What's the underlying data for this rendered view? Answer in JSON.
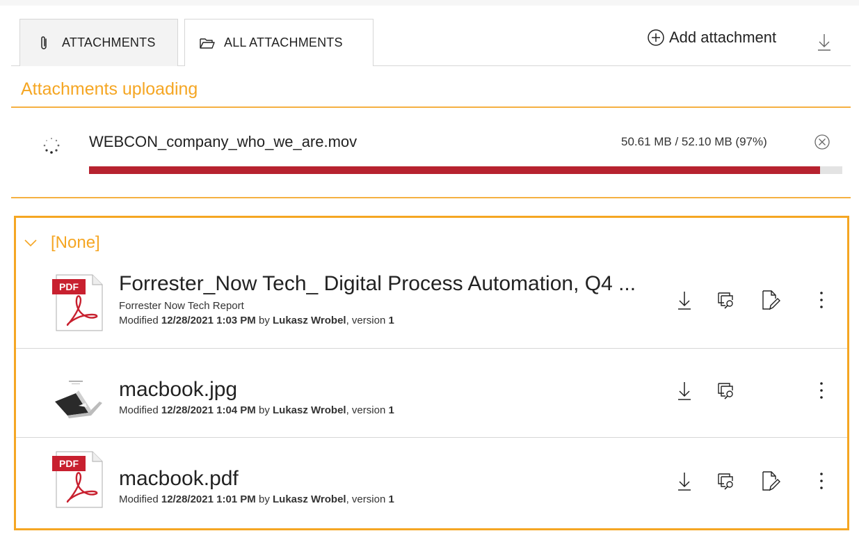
{
  "tabs": [
    {
      "label": "ATTACHMENTS",
      "icon": "paperclip-icon",
      "active": true
    },
    {
      "label": "ALL ATTACHMENTS",
      "icon": "folder-open-icon",
      "active": false
    }
  ],
  "toolbar": {
    "add_attachment_label": "Add attachment",
    "add_icon": "plus-circle-icon",
    "download_all_icon": "download-icon"
  },
  "uploading": {
    "title": "Attachments uploading",
    "file": {
      "name": "WEBCON_company_who_we_are.mov",
      "progress_text": "50.61 MB / 52.10 MB (97%)",
      "progress_fraction": 0.97
    }
  },
  "group": {
    "name": "[None]",
    "expanded": true,
    "files": [
      {
        "name": "Forrester_Now Tech_ Digital Process Automation, Q4 ...",
        "description": "Forrester Now Tech Report",
        "type": "pdf",
        "thumb_label": "PDF",
        "meta_prefix": "Modified ",
        "modified": "12/28/2021 1:03 PM",
        "meta_by": " by ",
        "author": "Lukasz Wrobel",
        "meta_version": ", version ",
        "version": "1",
        "can_edit": true
      },
      {
        "name": "macbook.jpg",
        "description": "",
        "type": "image",
        "thumb_label": "",
        "meta_prefix": "Modified ",
        "modified": "12/28/2021 1:04 PM",
        "meta_by": " by ",
        "author": "Lukasz Wrobel",
        "meta_version": ", version ",
        "version": "1",
        "can_edit": false
      },
      {
        "name": "macbook.pdf",
        "description": "",
        "type": "pdf",
        "thumb_label": "PDF",
        "meta_prefix": "Modified ",
        "modified": "12/28/2021 1:01 PM",
        "meta_by": " by ",
        "author": "Lukasz Wrobel",
        "meta_version": ", version ",
        "version": "1",
        "can_edit": true
      }
    ]
  },
  "colors": {
    "accent_orange": "#f5a623",
    "progress_red": "#b7222f",
    "pdf_red": "#c8202f",
    "border_gray": "#d6d6d6"
  }
}
